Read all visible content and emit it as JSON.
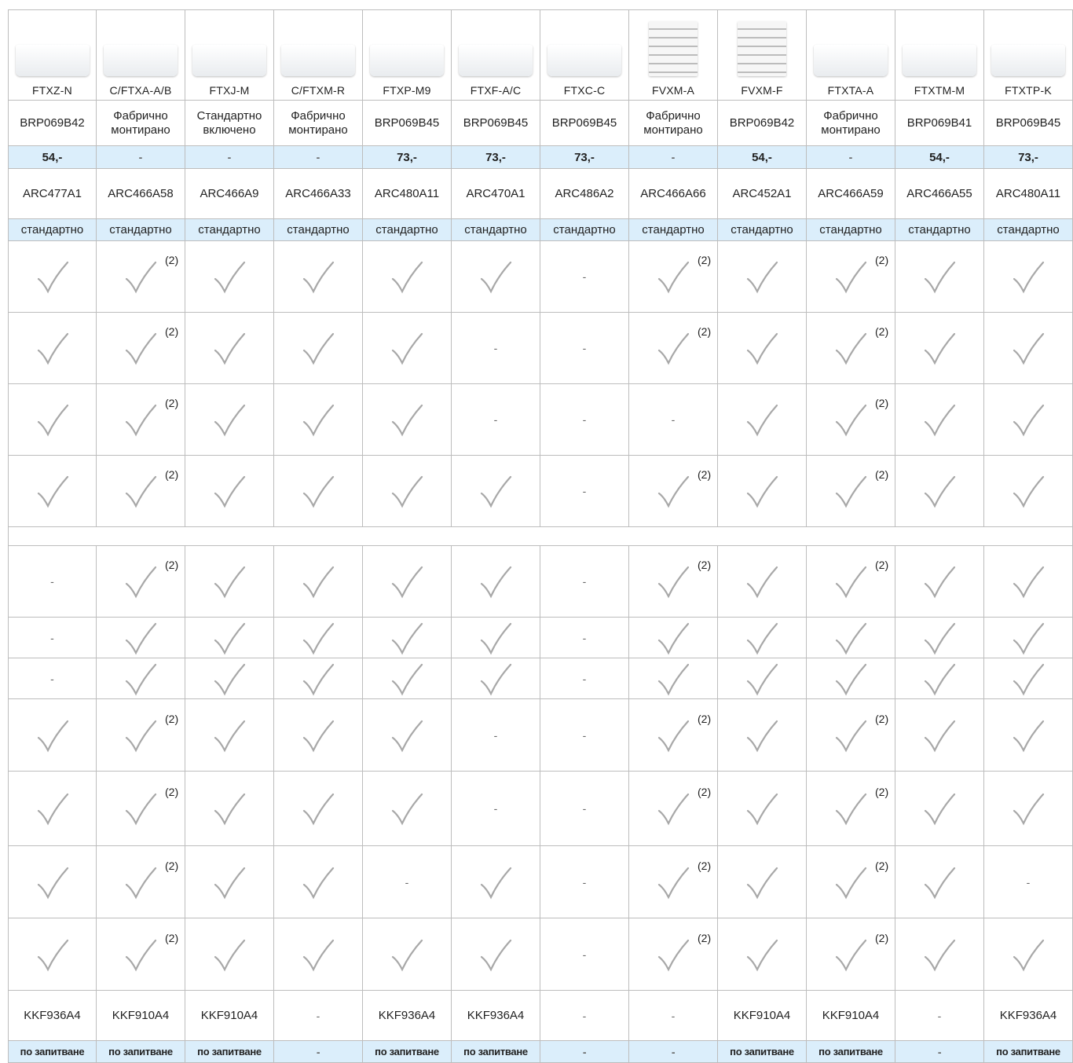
{
  "models": [
    "FTXZ-N",
    "C/FTXA-A/B",
    "FTXJ-M",
    "C/FTXM-R",
    "FTXP-M9",
    "FTXF-A/C",
    "FTXC-C",
    "FVXM-A",
    "FVXM-F",
    "FTXTA-A",
    "FTXTM-M",
    "FTXTP-K"
  ],
  "unit_types": [
    "wall",
    "wall",
    "wall",
    "wall",
    "wall",
    "wall",
    "wall",
    "floor",
    "floor",
    "wall",
    "wall",
    "wall"
  ],
  "wifi_adapter": [
    "BRP069B42",
    [
      "Фабрично",
      "монтирано"
    ],
    [
      "Стандартно",
      "включено"
    ],
    [
      "Фабрично",
      "монтирано"
    ],
    "BRP069B45",
    "BRP069B45",
    "BRP069B45",
    [
      "Фабрично",
      "монтирано"
    ],
    "BRP069B42",
    [
      "Фабрично",
      "монтирано"
    ],
    "BRP069B41",
    "BRP069B45"
  ],
  "prices": [
    "54,-",
    "-",
    "-",
    "-",
    "73,-",
    "73,-",
    "73,-",
    "-",
    "54,-",
    "-",
    "54,-",
    "73,-"
  ],
  "remotes": [
    "ARC477A1",
    "ARC466A58",
    "ARC466A9",
    "ARC466A33",
    "ARC480A11",
    "ARC470A1",
    "ARC486A2",
    "ARC466A66",
    "ARC452A1",
    "ARC466A59",
    "ARC466A55",
    "ARC480A11"
  ],
  "remote_status": [
    "стандартно",
    "стандартно",
    "стандартно",
    "стандартно",
    "стандартно",
    "стандартно",
    "стандартно",
    "стандартно",
    "стандартно",
    "стандартно",
    "стандартно",
    "стандартно"
  ],
  "check_note": "(2)",
  "dash": "-",
  "feature_rows": [
    [
      "c",
      "c2",
      "c",
      "c",
      "c",
      "c",
      "-",
      "c2",
      "c",
      "c2",
      "c",
      "c"
    ],
    [
      "c",
      "c2",
      "c",
      "c",
      "c",
      "-",
      "-",
      "c2",
      "c",
      "c2",
      "c",
      "c"
    ],
    [
      "c",
      "c2",
      "c",
      "c",
      "c",
      "-",
      "-",
      "-",
      "c",
      "c2",
      "c",
      "c"
    ],
    [
      "c",
      "c2",
      "c",
      "c",
      "c",
      "c",
      "-",
      "c2",
      "c",
      "c2",
      "c",
      "c"
    ],
    [
      "-",
      "c2",
      "c",
      "c",
      "c",
      "c",
      "-",
      "c2",
      "c",
      "c2",
      "c",
      "c"
    ],
    [
      "-",
      "c",
      "c",
      "c",
      "c",
      "c",
      "-",
      "c",
      "c",
      "c",
      "c",
      "c"
    ],
    [
      "-",
      "c",
      "c",
      "c",
      "c",
      "c",
      "-",
      "c",
      "c",
      "c",
      "c",
      "c"
    ],
    [
      "c",
      "c2",
      "c",
      "c",
      "c",
      "-",
      "-",
      "c2",
      "c",
      "c2",
      "c",
      "c"
    ],
    [
      "c",
      "c2",
      "c",
      "c",
      "c",
      "-",
      "-",
      "c2",
      "c",
      "c2",
      "c",
      "c"
    ],
    [
      "c",
      "c2",
      "c",
      "c",
      "-",
      "c",
      "-",
      "c2",
      "c",
      "c2",
      "c",
      "-"
    ],
    [
      "c",
      "c2",
      "c",
      "c",
      "c",
      "c",
      "-",
      "c2",
      "c",
      "c2",
      "c",
      "c"
    ]
  ],
  "filters": [
    "KKF936A4",
    "KKF910A4",
    "KKF910A4",
    "-",
    "KKF936A4",
    "KKF936A4",
    "-",
    "-",
    "KKF910A4",
    "KKF910A4",
    "-",
    "KKF936A4"
  ],
  "filter_availability": [
    "по запитване",
    "по запитване",
    "по запитване",
    "-",
    "по запитване",
    "по запитване",
    "-",
    "-",
    "по запитване",
    "по запитване",
    "-",
    "по запитване"
  ],
  "colors": {
    "blue_row": "#dbeefb",
    "border": "#bdbdbd",
    "check": "#a8a8a8"
  }
}
